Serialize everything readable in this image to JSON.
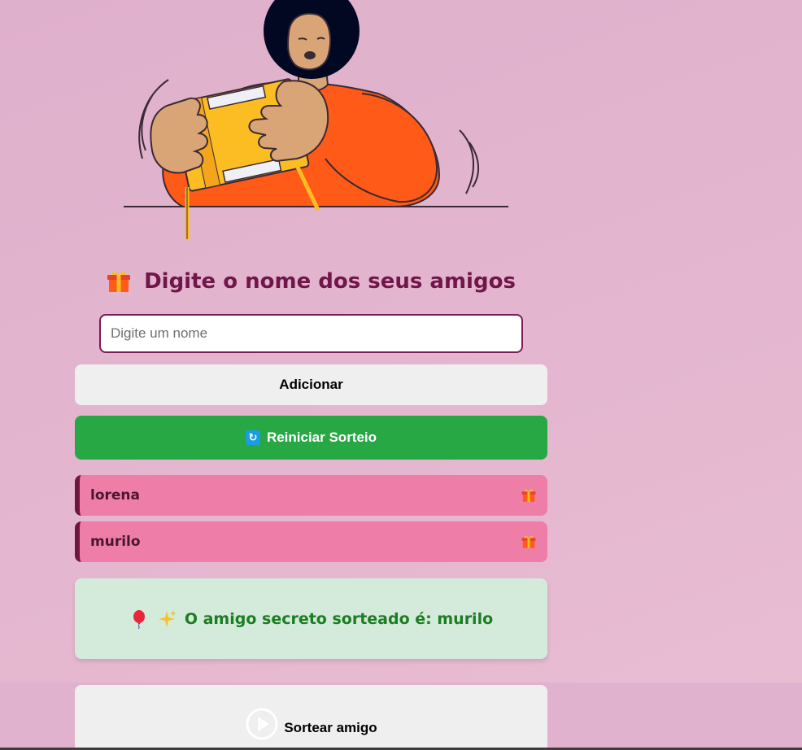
{
  "main": {
    "title": "Digite o nome dos seus amigos",
    "input": {
      "placeholder": "Digite um nome",
      "value": ""
    },
    "add_button_label": "Adicionar",
    "reset_button_label": "Reiniciar Sorteio",
    "friends": [
      {
        "name": "lorena",
        "icon": "gift-icon"
      },
      {
        "name": "murilo",
        "icon": "gift-icon"
      }
    ],
    "result_text": "O amigo secreto sorteado é: murilo",
    "draw_button_label": "Sortear amigo"
  },
  "colors": {
    "background": "#e2b3cd",
    "title": "#70164a",
    "input_border": "#7a1d52",
    "button_neutral": "#efefef",
    "button_reset": "#28a745",
    "friend_item": "#ee7ea7",
    "friend_border": "#6e1640",
    "result_bg": "#d4eadb",
    "result_text": "#1c7d22",
    "illustration_orange": "#ff5a17",
    "illustration_box": "#fbbd22"
  },
  "icons": {
    "title_icon": "gift-icon",
    "reset_icon": "refresh-icon",
    "result_icons": [
      "balloon-icon",
      "sparkles-icon"
    ],
    "draw_icon": "play-circle-icon"
  }
}
